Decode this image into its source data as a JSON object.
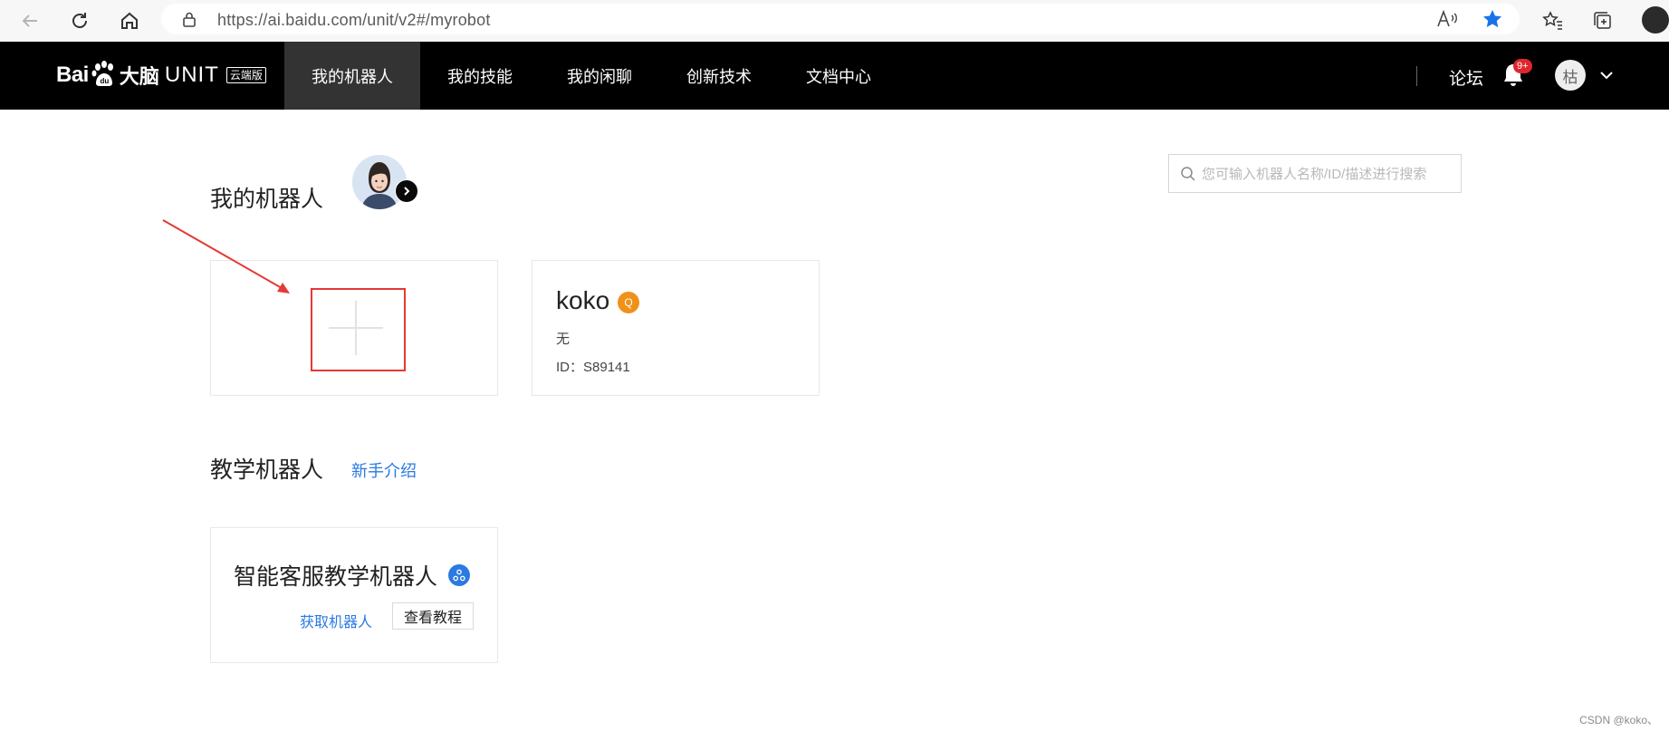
{
  "browser": {
    "url": "https://ai.baidu.com/unit/v2#/myrobot"
  },
  "header": {
    "logo_bai": "Bai",
    "logo_danao": "大脑",
    "logo_unit": "UNIT",
    "logo_badge": "云端版",
    "nav": [
      {
        "label": "我的机器人",
        "active": true
      },
      {
        "label": "我的技能",
        "active": false
      },
      {
        "label": "我的闲聊",
        "active": false
      },
      {
        "label": "创新技术",
        "active": false
      },
      {
        "label": "文档中心",
        "active": false
      }
    ],
    "forum": "论坛",
    "notification_badge": "9+",
    "user_initial": "枯"
  },
  "my_robots": {
    "title": "我的机器人",
    "search_placeholder": "您可输入机器人名称/ID/描述进行搜索",
    "robot": {
      "name": "koko",
      "badge": "Q",
      "description": "无",
      "id_text": "ID：S89141"
    }
  },
  "teaching": {
    "title": "教学机器人",
    "intro_link": "新手介绍",
    "robot": {
      "name": "智能客服教学机器人",
      "get_label": "获取机器人",
      "tutorial_label": "查看教程"
    }
  },
  "watermark": "CSDN @koko、",
  "colors": {
    "header_bg": "#000000",
    "active_nav_bg": "#333333",
    "link_blue": "#2a7ae2",
    "badge_orange": "#f0911b",
    "annotation_red": "#e53935"
  }
}
